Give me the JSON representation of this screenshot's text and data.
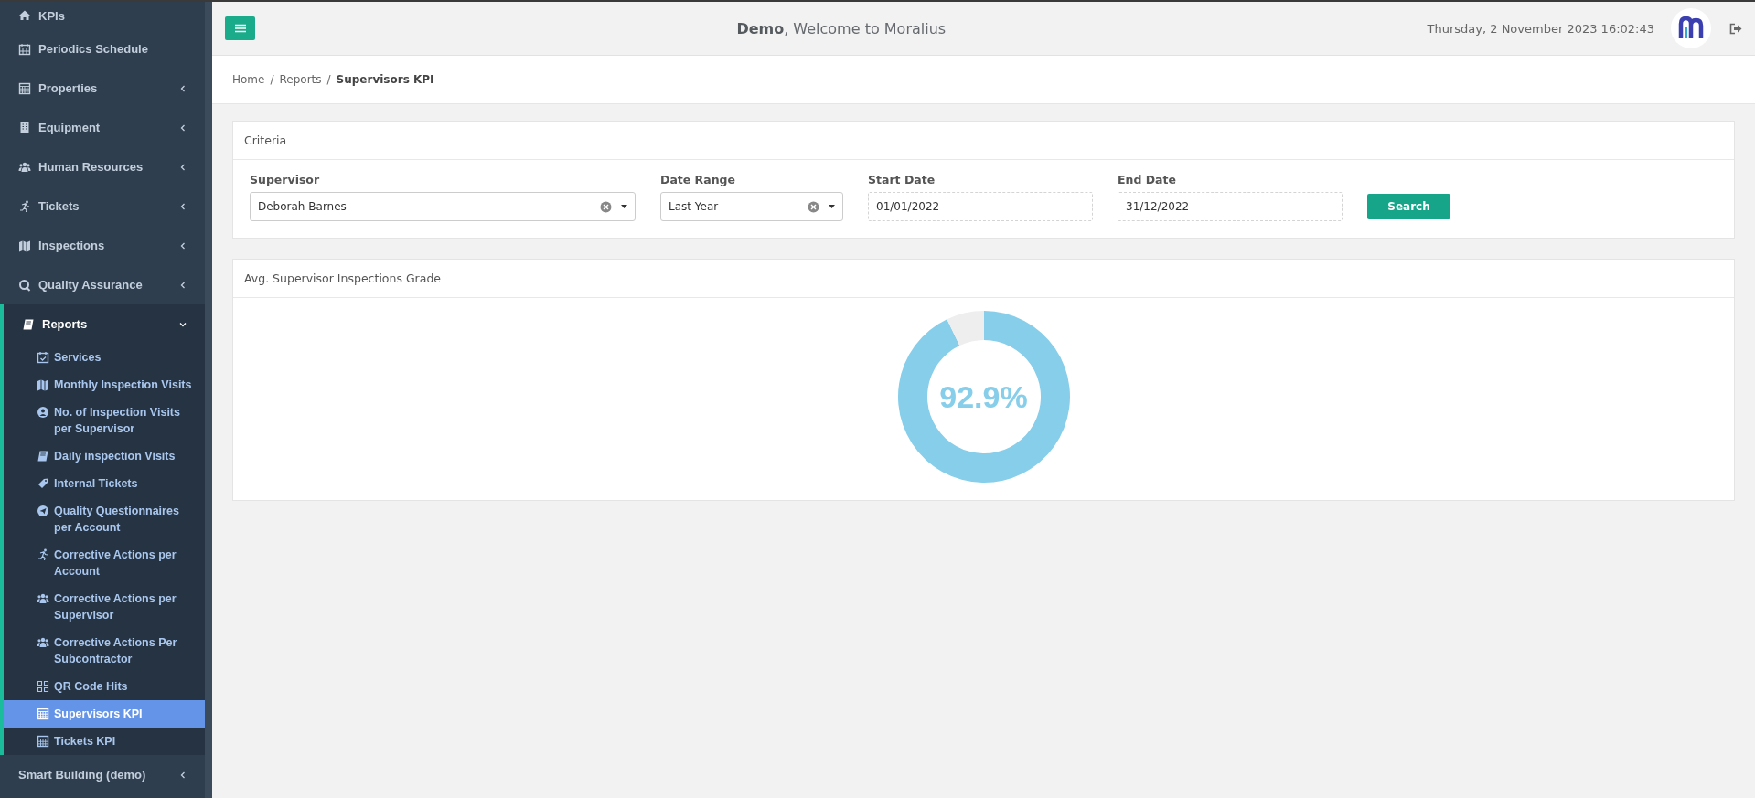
{
  "sidebar": {
    "items": [
      {
        "label": "KPIs"
      },
      {
        "label": "Periodics Schedule"
      },
      {
        "label": "Properties",
        "expanded": false
      },
      {
        "label": "Equipment",
        "expanded": false
      },
      {
        "label": "Human Resources",
        "expanded": false
      },
      {
        "label": "Tickets",
        "expanded": false
      },
      {
        "label": "Inspections",
        "expanded": false
      },
      {
        "label": "Quality Assurance",
        "expanded": false
      },
      {
        "label": "Reports",
        "expanded": true,
        "children": [
          {
            "label": "Services",
            "selected": false
          },
          {
            "label": "Monthly Inspection Visits",
            "selected": false
          },
          {
            "label": "No. of Inspection Visits per Supervisor",
            "selected": false
          },
          {
            "label": "Daily inspection Visits",
            "selected": false
          },
          {
            "label": "Internal Tickets",
            "selected": false
          },
          {
            "label": "Quality Questionnaires per Account",
            "selected": false
          },
          {
            "label": "Corrective Actions per Account",
            "selected": false
          },
          {
            "label": "Corrective Actions per Supervisor",
            "selected": false
          },
          {
            "label": "Corrective Actions Per Subcontractor",
            "selected": false
          },
          {
            "label": "QR Code Hits",
            "selected": false
          },
          {
            "label": "Supervisors KPI",
            "selected": true
          },
          {
            "label": "Tickets KPI",
            "selected": false
          }
        ]
      },
      {
        "label": "Smart Building (demo)",
        "expanded": false
      }
    ]
  },
  "header": {
    "title": "**Demo**, Welcome to Moralius",
    "datetime": "Thursday, 2 November 2023 16:02:43"
  },
  "breadcrumb": [
    {
      "label": "Home",
      "separator": "/",
      "current": false
    },
    {
      "label": "Reports",
      "separator": "/",
      "current": false
    },
    {
      "label": "Supervisors KPI",
      "current": true
    }
  ],
  "criteria": {
    "title": "Criteria",
    "fields": [
      {
        "kind": "select",
        "label": "Supervisor",
        "value": "Deborah Barnes"
      },
      {
        "kind": "select",
        "label": "Date Range",
        "value": "Last Year"
      },
      {
        "kind": "date",
        "label": "Start Date",
        "value": "01/01/2022"
      },
      {
        "kind": "date",
        "label": "End Date",
        "value": "31/12/2022"
      }
    ],
    "button": "Search"
  },
  "grade_card": {
    "title": "Avg. Supervisor Inspections Grade",
    "chart_data": {
      "type": "donut",
      "values": [
        92.9,
        7.1
      ]
    },
    "reading": "92.9%"
  }
}
